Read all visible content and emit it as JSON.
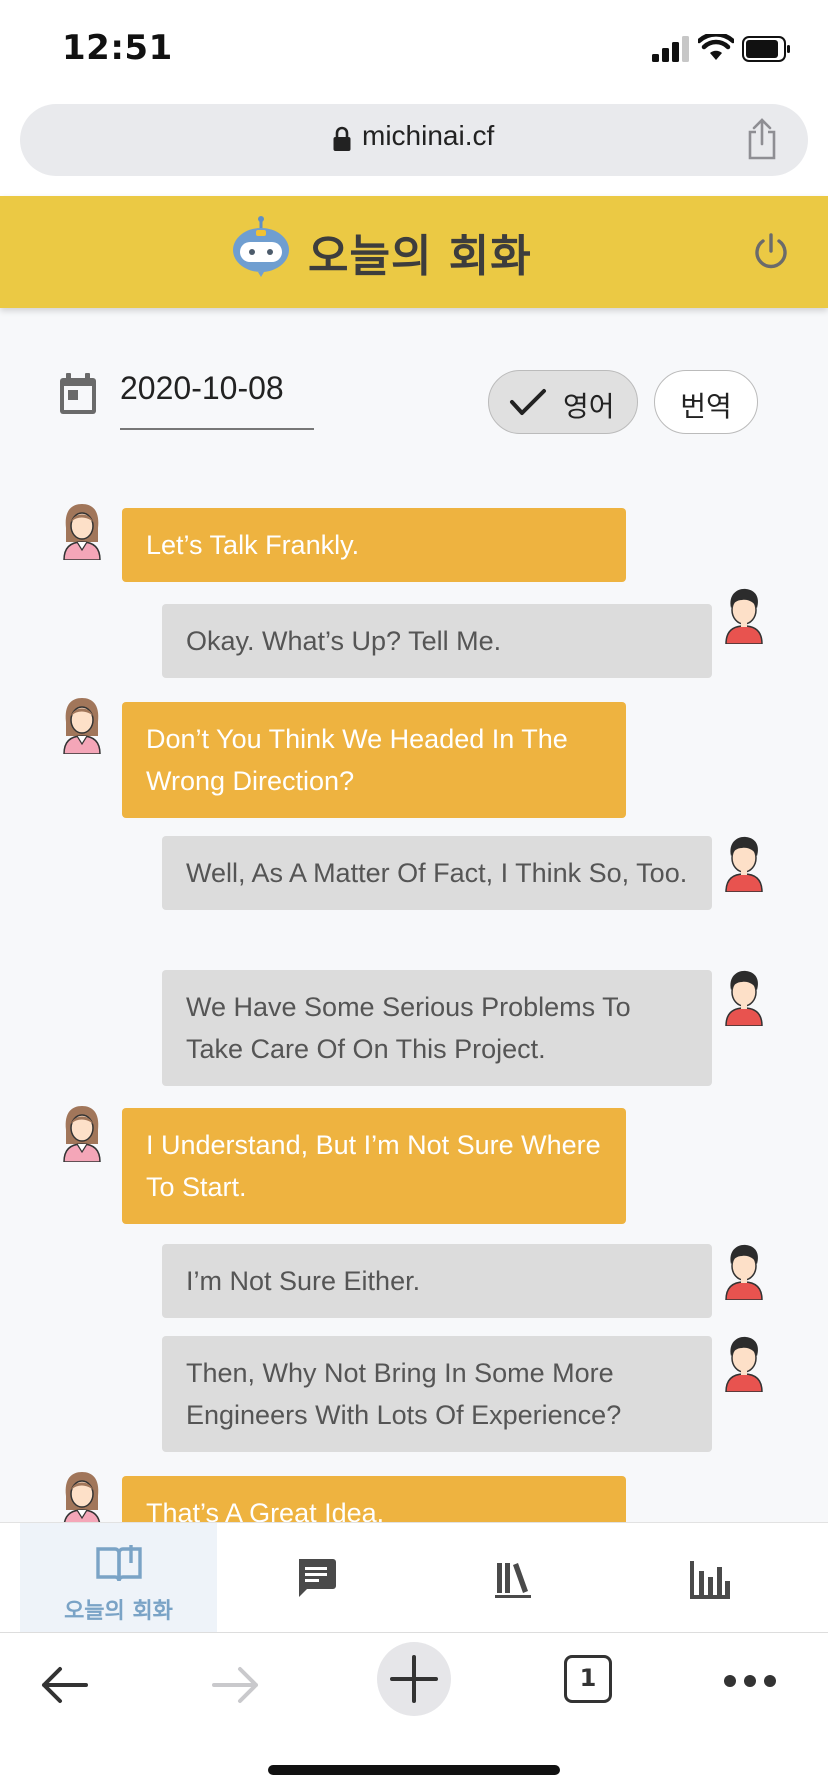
{
  "status_bar": {
    "time": "12:51"
  },
  "browser": {
    "url": "michinai.cf",
    "tabs_count": "1"
  },
  "header": {
    "title": "오늘의 회화"
  },
  "controls": {
    "date": "2020-10-08",
    "language_label": "영어",
    "translate_label": "번역"
  },
  "colors": {
    "header": "#ebc944",
    "female_bubble": "#eeb340",
    "male_bubble": "#dcdcdc",
    "nav_active": "#7aa3c6"
  },
  "messages": [
    {
      "speaker": "female",
      "text": "Let’s Talk Frankly."
    },
    {
      "speaker": "male",
      "text": "Okay. What’s Up? Tell Me."
    },
    {
      "speaker": "female",
      "text": "Don’t You Think We Headed In The Wrong Direction?"
    },
    {
      "speaker": "male",
      "text": "Well, As A Matter Of Fact, I Think So, Too."
    },
    {
      "speaker": "male",
      "text": "We Have Some Serious Problems To Take Care Of On This Project."
    },
    {
      "speaker": "female",
      "text": "I Understand, But I’m Not Sure Where To Start."
    },
    {
      "speaker": "male",
      "text": "I’m Not Sure Either."
    },
    {
      "speaker": "male",
      "text": "Then, Why Not Bring In Some More Engineers With Lots Of Experience?"
    },
    {
      "speaker": "female",
      "text": "That’s A Great Idea."
    }
  ],
  "bottom_nav": {
    "items": [
      {
        "label": "오늘의 회화",
        "icon": "book-open-icon",
        "active": true
      },
      {
        "label": "",
        "icon": "chat-icon",
        "active": false
      },
      {
        "label": "",
        "icon": "library-icon",
        "active": false
      },
      {
        "label": "",
        "icon": "bar-chart-icon",
        "active": false
      }
    ]
  }
}
